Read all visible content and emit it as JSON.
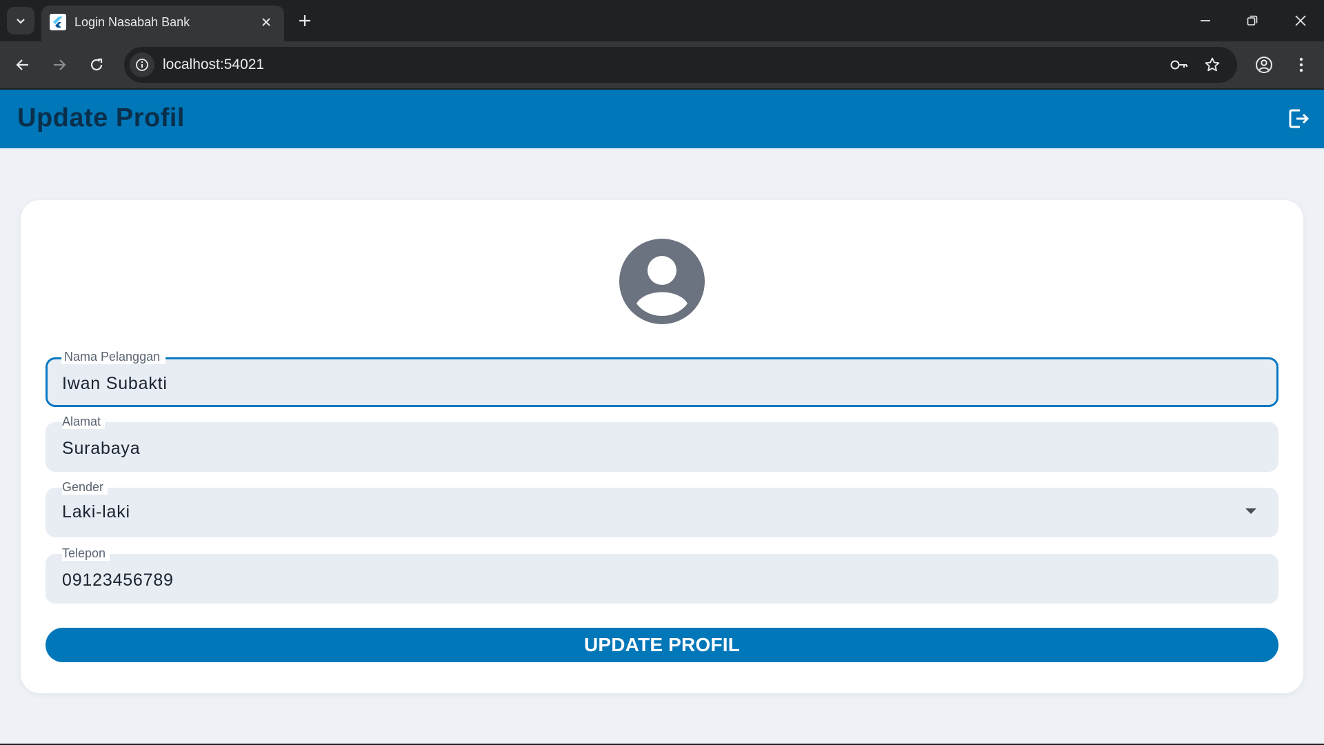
{
  "browser": {
    "tab_title": "Login Nasabah Bank",
    "url": "localhost:54021",
    "icons": {
      "tab_search": "chevron-down-icon",
      "favicon": "flutter-logo-icon",
      "tab_close": "close-icon",
      "new_tab": "plus-icon",
      "minimize": "minimize-icon",
      "restore": "restore-icon",
      "close_window": "close-icon",
      "back": "arrow-left-icon",
      "forward": "arrow-right-icon",
      "reload": "reload-icon",
      "site_info": "info-icon",
      "passwords": "key-icon",
      "bookmark": "star-icon",
      "profile": "account-circle-icon",
      "menu": "more-vert-icon"
    }
  },
  "app": {
    "title": "Update Profil",
    "logout_icon": "logout-icon",
    "avatar_icon": "account-circle-icon",
    "colors": {
      "primary": "#0077b8",
      "background": "#eef2f7",
      "field_fill": "#e8edf4"
    }
  },
  "form": {
    "nama": {
      "label": "Nama Pelanggan",
      "value": "Iwan Subakti"
    },
    "alamat": {
      "label": "Alamat",
      "value": "Surabaya"
    },
    "gender": {
      "label": "Gender",
      "value": "Laki-laki"
    },
    "telepon": {
      "label": "Telepon",
      "value": "09123456789"
    },
    "submit_label": "UPDATE PROFIL"
  }
}
